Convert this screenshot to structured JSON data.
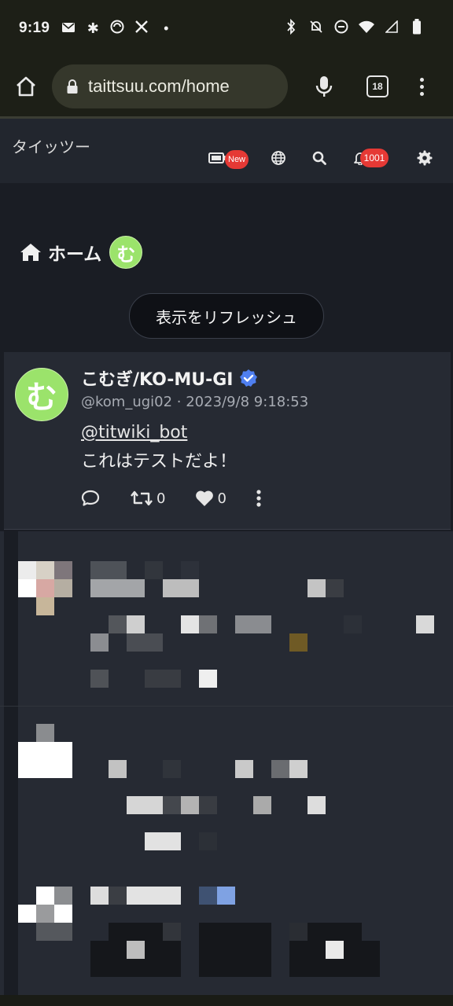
{
  "status_bar": {
    "time": "9:19",
    "left_icons": [
      "mail-icon",
      "pinwheel-icon",
      "app-icon",
      "x-icon",
      "dot-icon"
    ],
    "right_icons": [
      "bluetooth-icon",
      "bell-off-icon",
      "dnd-icon",
      "wifi-icon",
      "signal-icon",
      "battery-icon"
    ]
  },
  "browser": {
    "url": "taittsuu.com/home",
    "tab_count": "18"
  },
  "site_header": {
    "brand": "タイッツー",
    "badge_new": "New",
    "notification_count": "1001"
  },
  "page": {
    "title": "ホーム",
    "avatar_glyph": "む",
    "refresh_button": "表示をリフレッシュ"
  },
  "post": {
    "avatar_glyph": "む",
    "display_name": "こむぎ/KO-MU-GI",
    "handle_time": "@kom_ugi02 · 2023/9/8 9:18:53",
    "mention": "@titwiki_bot",
    "text": "これはテストだよ！",
    "retweet_count": "0",
    "like_count": "0"
  },
  "colors": {
    "badge": "#e53935",
    "avatar": "#9be36b",
    "verified": "#4f7ff0"
  }
}
